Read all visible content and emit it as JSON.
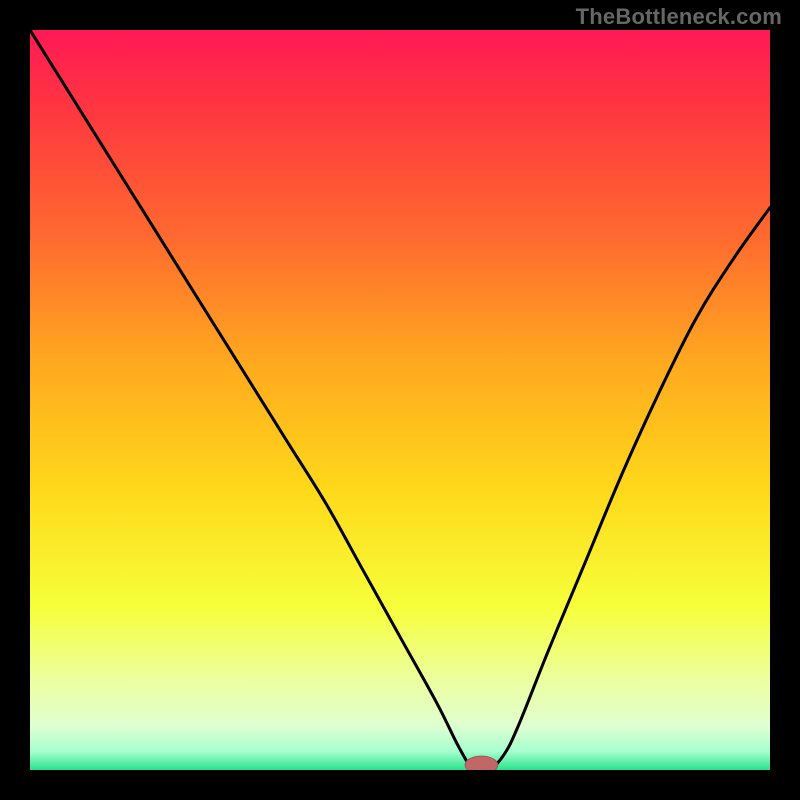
{
  "watermark": "TheBottleneck.com",
  "colors": {
    "frame": "#000000",
    "curve": "#000000",
    "marker_fill": "#c06868",
    "marker_stroke": "#b05050",
    "gradient_stops": [
      {
        "offset": 0.0,
        "color": "#ff1955"
      },
      {
        "offset": 0.12,
        "color": "#ff3a3f"
      },
      {
        "offset": 0.28,
        "color": "#ff6a2f"
      },
      {
        "offset": 0.45,
        "color": "#ffa91f"
      },
      {
        "offset": 0.62,
        "color": "#ffd81a"
      },
      {
        "offset": 0.78,
        "color": "#f6ff3a"
      },
      {
        "offset": 0.88,
        "color": "#ecffa0"
      },
      {
        "offset": 0.94,
        "color": "#dfffd0"
      },
      {
        "offset": 0.975,
        "color": "#a6ffcf"
      },
      {
        "offset": 1.0,
        "color": "#28e28c"
      }
    ]
  },
  "chart_data": {
    "type": "line",
    "title": "",
    "xlabel": "",
    "ylabel": "",
    "xlim": [
      0,
      100
    ],
    "ylim": [
      0,
      100
    ],
    "series": [
      {
        "name": "bottleneck-curve",
        "x": [
          0,
          5,
          10,
          15,
          20,
          25,
          30,
          35,
          40,
          45,
          50,
          55,
          58,
          60,
          62,
          64,
          66,
          70,
          75,
          80,
          85,
          90,
          95,
          100
        ],
        "values": [
          100,
          92,
          84,
          76,
          68,
          60,
          52,
          44,
          36,
          27,
          18,
          9,
          3,
          0,
          0,
          2,
          6,
          16,
          28,
          40,
          51,
          61,
          69,
          76
        ]
      }
    ],
    "marker": {
      "name": "optimal-point",
      "x": 61,
      "y": 0,
      "rx": 2.2,
      "ry": 1.2
    },
    "grid": false,
    "legend": false
  }
}
